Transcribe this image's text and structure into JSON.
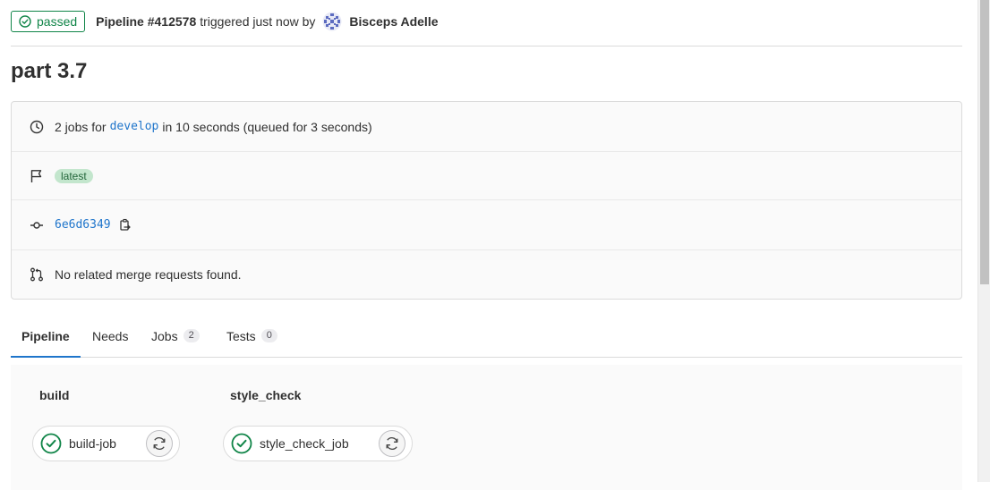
{
  "header": {
    "status": "passed",
    "pipeline_title": "Pipeline #412578",
    "pipeline_text": "triggered just now by",
    "user_name": "Bisceps Adelle"
  },
  "page_title": "part 3.7",
  "info": {
    "jobs_prefix": "2 jobs for",
    "branch": "develop",
    "jobs_suffix": "in 10 seconds (queued for 3 seconds)",
    "tag": "latest",
    "commit_sha": "6e6d6349",
    "merge_requests": "No related merge requests found."
  },
  "tabs": [
    {
      "label": "Pipeline"
    },
    {
      "label": "Needs"
    },
    {
      "label": "Jobs",
      "count": "2"
    },
    {
      "label": "Tests",
      "count": "0"
    }
  ],
  "stages": [
    {
      "name": "build",
      "jobs": [
        {
          "name": "build-job",
          "status": "success"
        }
      ]
    },
    {
      "name": "style_check",
      "jobs": [
        {
          "name": "style_check_job",
          "status": "success"
        }
      ]
    }
  ],
  "colors": {
    "success": "#108548",
    "link": "#1f75cb",
    "active_tab": "#1f75cb"
  },
  "icons": {
    "status": "check-circle-icon",
    "duration": "clock-icon",
    "tag": "flag-icon",
    "commit": "commit-icon",
    "copy": "copy-icon",
    "merge_request": "merge-request-icon",
    "retry": "retry-icon"
  }
}
